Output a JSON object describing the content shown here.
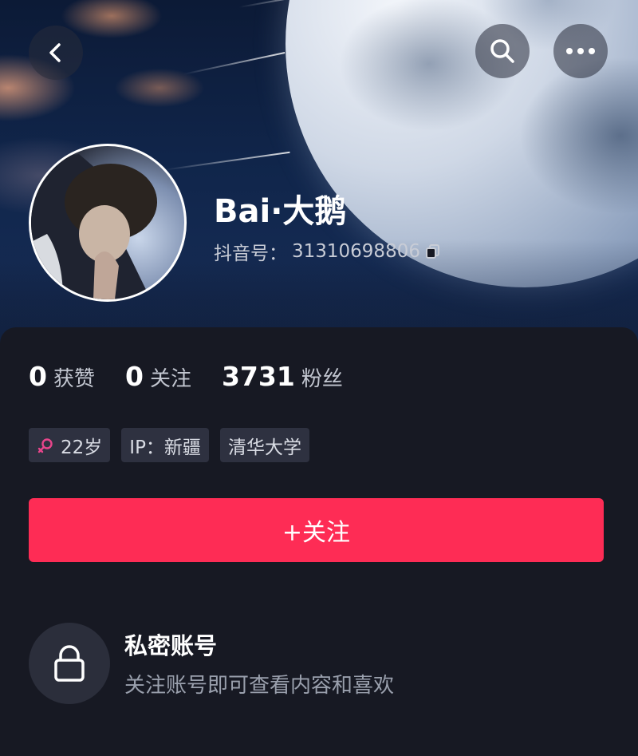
{
  "profile": {
    "name": "Bai·大鹅",
    "uid_label": "抖音号：",
    "uid_value": "31310698806"
  },
  "stats": {
    "likes_num": "0",
    "likes_label": "获赞",
    "following_num": "0",
    "following_label": "关注",
    "fans_num": "3731",
    "fans_label": "粉丝"
  },
  "tags": {
    "age": "22岁",
    "ip": "IP：新疆",
    "school": "清华大学"
  },
  "follow_button": {
    "label": "+关注"
  },
  "private": {
    "title": "私密账号",
    "subtitle": "关注账号即可查看内容和喜欢"
  },
  "icons": {
    "back": "chevron-left-icon",
    "search": "search-icon",
    "more": "more-horizontal-icon",
    "copy": "copy-icon",
    "gender": "female-icon",
    "lock": "lock-icon"
  },
  "colors": {
    "accent": "#fe2c55",
    "gender": "#e8458b"
  }
}
